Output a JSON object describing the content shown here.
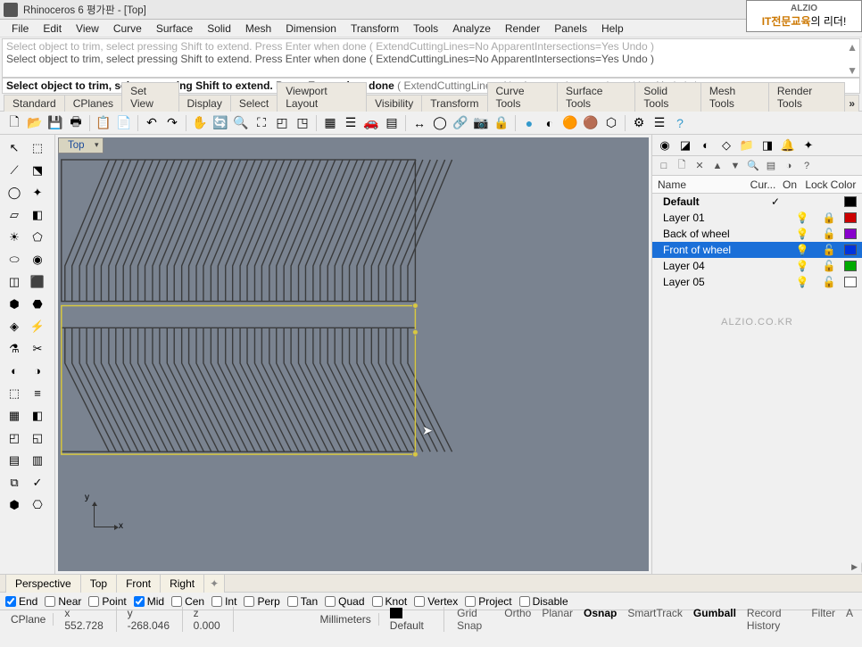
{
  "title": "Rhinoceros 6 평가판 - [Top]",
  "logo": {
    "l1": "ALZIO",
    "l2": "IT전문교육",
    "l2s": "의 리더!"
  },
  "menu": [
    "File",
    "Edit",
    "View",
    "Curve",
    "Surface",
    "Solid",
    "Mesh",
    "Dimension",
    "Transform",
    "Tools",
    "Analyze",
    "Render",
    "Panels",
    "Help"
  ],
  "cmd_hist": [
    "Select object to trim, select pressing Shift to extend. Press Enter when done ( ExtendCuttingLines=No  ApparentIntersections=Yes  Undo )",
    "Select object to trim, select pressing Shift to extend. Press Enter when done ( ExtendCuttingLines=No  ApparentIntersections=Yes  Undo )"
  ],
  "cmd_bold": "Select object to trim, select pressing Shift to extend. Press Enter when done",
  "cmd_opts": " ( ExtendCuttingLines=No  ApparentIntersections=Yes  Undo ): ",
  "tool_tabs": [
    "Standard",
    "CPlanes",
    "Set View",
    "Display",
    "Select",
    "Viewport Layout",
    "Visibility",
    "Transform",
    "Curve Tools",
    "Surface Tools",
    "Solid Tools",
    "Mesh Tools",
    "Render Tools"
  ],
  "vp_label": "Top",
  "axis": {
    "x": "x",
    "y": "y"
  },
  "rp_tabs_icons": [
    "◉",
    "◪",
    "◐",
    "◇",
    "📁",
    "◨",
    "🔔",
    "✦"
  ],
  "rp_tool_icons": [
    "□",
    "🗋",
    "✕",
    "▲",
    "▼",
    "🔍",
    "▤",
    "◑",
    "?"
  ],
  "layers_hdr": {
    "name": "Name",
    "cur": "Cur...",
    "on": "On",
    "lock": "Lock",
    "col": "Color"
  },
  "layers": [
    {
      "name": "Default",
      "cur": "✓",
      "on": "",
      "lock": "",
      "col": "#000000",
      "bold": true
    },
    {
      "name": "Layer 01",
      "cur": "",
      "on": "💡",
      "lock": "🔒",
      "col": "#cc0000"
    },
    {
      "name": "Back of wheel",
      "cur": "",
      "on": "💡",
      "lock": "🔓",
      "col": "#8800cc"
    },
    {
      "name": "Front of wheel",
      "cur": "",
      "on": "💡",
      "lock": "🔓",
      "col": "#0033dd",
      "sel": true
    },
    {
      "name": "Layer 04",
      "cur": "",
      "on": "💡",
      "lock": "🔓",
      "col": "#00aa00"
    },
    {
      "name": "Layer 05",
      "cur": "",
      "on": "💡",
      "lock": "🔓",
      "col": "#ffffff"
    }
  ],
  "watermark": "ALZIO.CO.KR",
  "view_tabs": [
    "Perspective",
    "Top",
    "Front",
    "Right"
  ],
  "osnap": [
    {
      "l": "End",
      "c": true
    },
    {
      "l": "Near",
      "c": false
    },
    {
      "l": "Point",
      "c": false
    },
    {
      "l": "Mid",
      "c": true
    },
    {
      "l": "Cen",
      "c": false
    },
    {
      "l": "Int",
      "c": false
    },
    {
      "l": "Perp",
      "c": false
    },
    {
      "l": "Tan",
      "c": false
    },
    {
      "l": "Quad",
      "c": false
    },
    {
      "l": "Knot",
      "c": false
    },
    {
      "l": "Vertex",
      "c": false
    },
    {
      "l": "Project",
      "c": false
    },
    {
      "l": "Disable",
      "c": false
    }
  ],
  "status": {
    "cplane": "CPlane",
    "x": "x 552.728",
    "y": "y -268.046",
    "z": "z 0.000",
    "units": "Millimeters",
    "layer": "Default",
    "snaps": [
      {
        "t": "Grid Snap",
        "b": false
      },
      {
        "t": "Ortho",
        "b": false
      },
      {
        "t": "Planar",
        "b": false
      },
      {
        "t": "Osnap",
        "b": true
      },
      {
        "t": "SmartTrack",
        "b": false
      },
      {
        "t": "Gumball",
        "b": true
      },
      {
        "t": "Record History",
        "b": false
      },
      {
        "t": "Filter",
        "b": false
      },
      {
        "t": "A",
        "b": false
      }
    ]
  }
}
